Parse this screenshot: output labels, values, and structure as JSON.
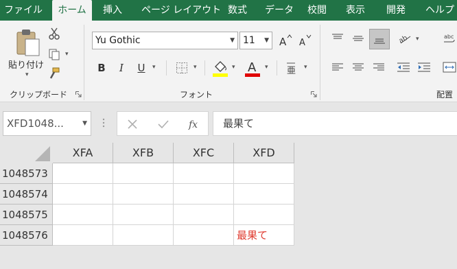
{
  "tabs": [
    {
      "label": "ファイル",
      "active": false
    },
    {
      "label": "ホーム",
      "active": true
    },
    {
      "label": "挿入",
      "active": false
    },
    {
      "label": "ページ レイアウト",
      "active": false
    },
    {
      "label": "数式",
      "active": false
    },
    {
      "label": "データ",
      "active": false
    },
    {
      "label": "校閲",
      "active": false
    },
    {
      "label": "表示",
      "active": false
    },
    {
      "label": "開発",
      "active": false
    },
    {
      "label": "ヘルプ",
      "active": false
    }
  ],
  "ribbon": {
    "clipboard": {
      "paste_label": "貼り付け",
      "group_label": "クリップボード"
    },
    "font": {
      "font_name": "Yu Gothic",
      "font_size": "11",
      "bold": "B",
      "italic": "I",
      "underline": "U",
      "group_label": "フォント"
    },
    "alignment": {
      "group_label": "配置"
    }
  },
  "formula_bar": {
    "name_box": "XFD1048...",
    "formula": "最果て"
  },
  "sheet": {
    "columns": [
      "XFA",
      "XFB",
      "XFC",
      "XFD"
    ],
    "rows": [
      {
        "label": "1048573",
        "cells": [
          "",
          "",
          "",
          ""
        ]
      },
      {
        "label": "1048574",
        "cells": [
          "",
          "",
          "",
          ""
        ]
      },
      {
        "label": "1048575",
        "cells": [
          "",
          "",
          "",
          ""
        ]
      },
      {
        "label": "1048576",
        "cells": [
          "",
          "",
          "",
          "最果て"
        ]
      }
    ],
    "text_color": "#e03c31"
  },
  "colors": {
    "accent": "#217346",
    "ribbon_bg": "#f3f3f3",
    "font_color_bar": "#e00000",
    "highlight_bar": "#ffff00"
  }
}
